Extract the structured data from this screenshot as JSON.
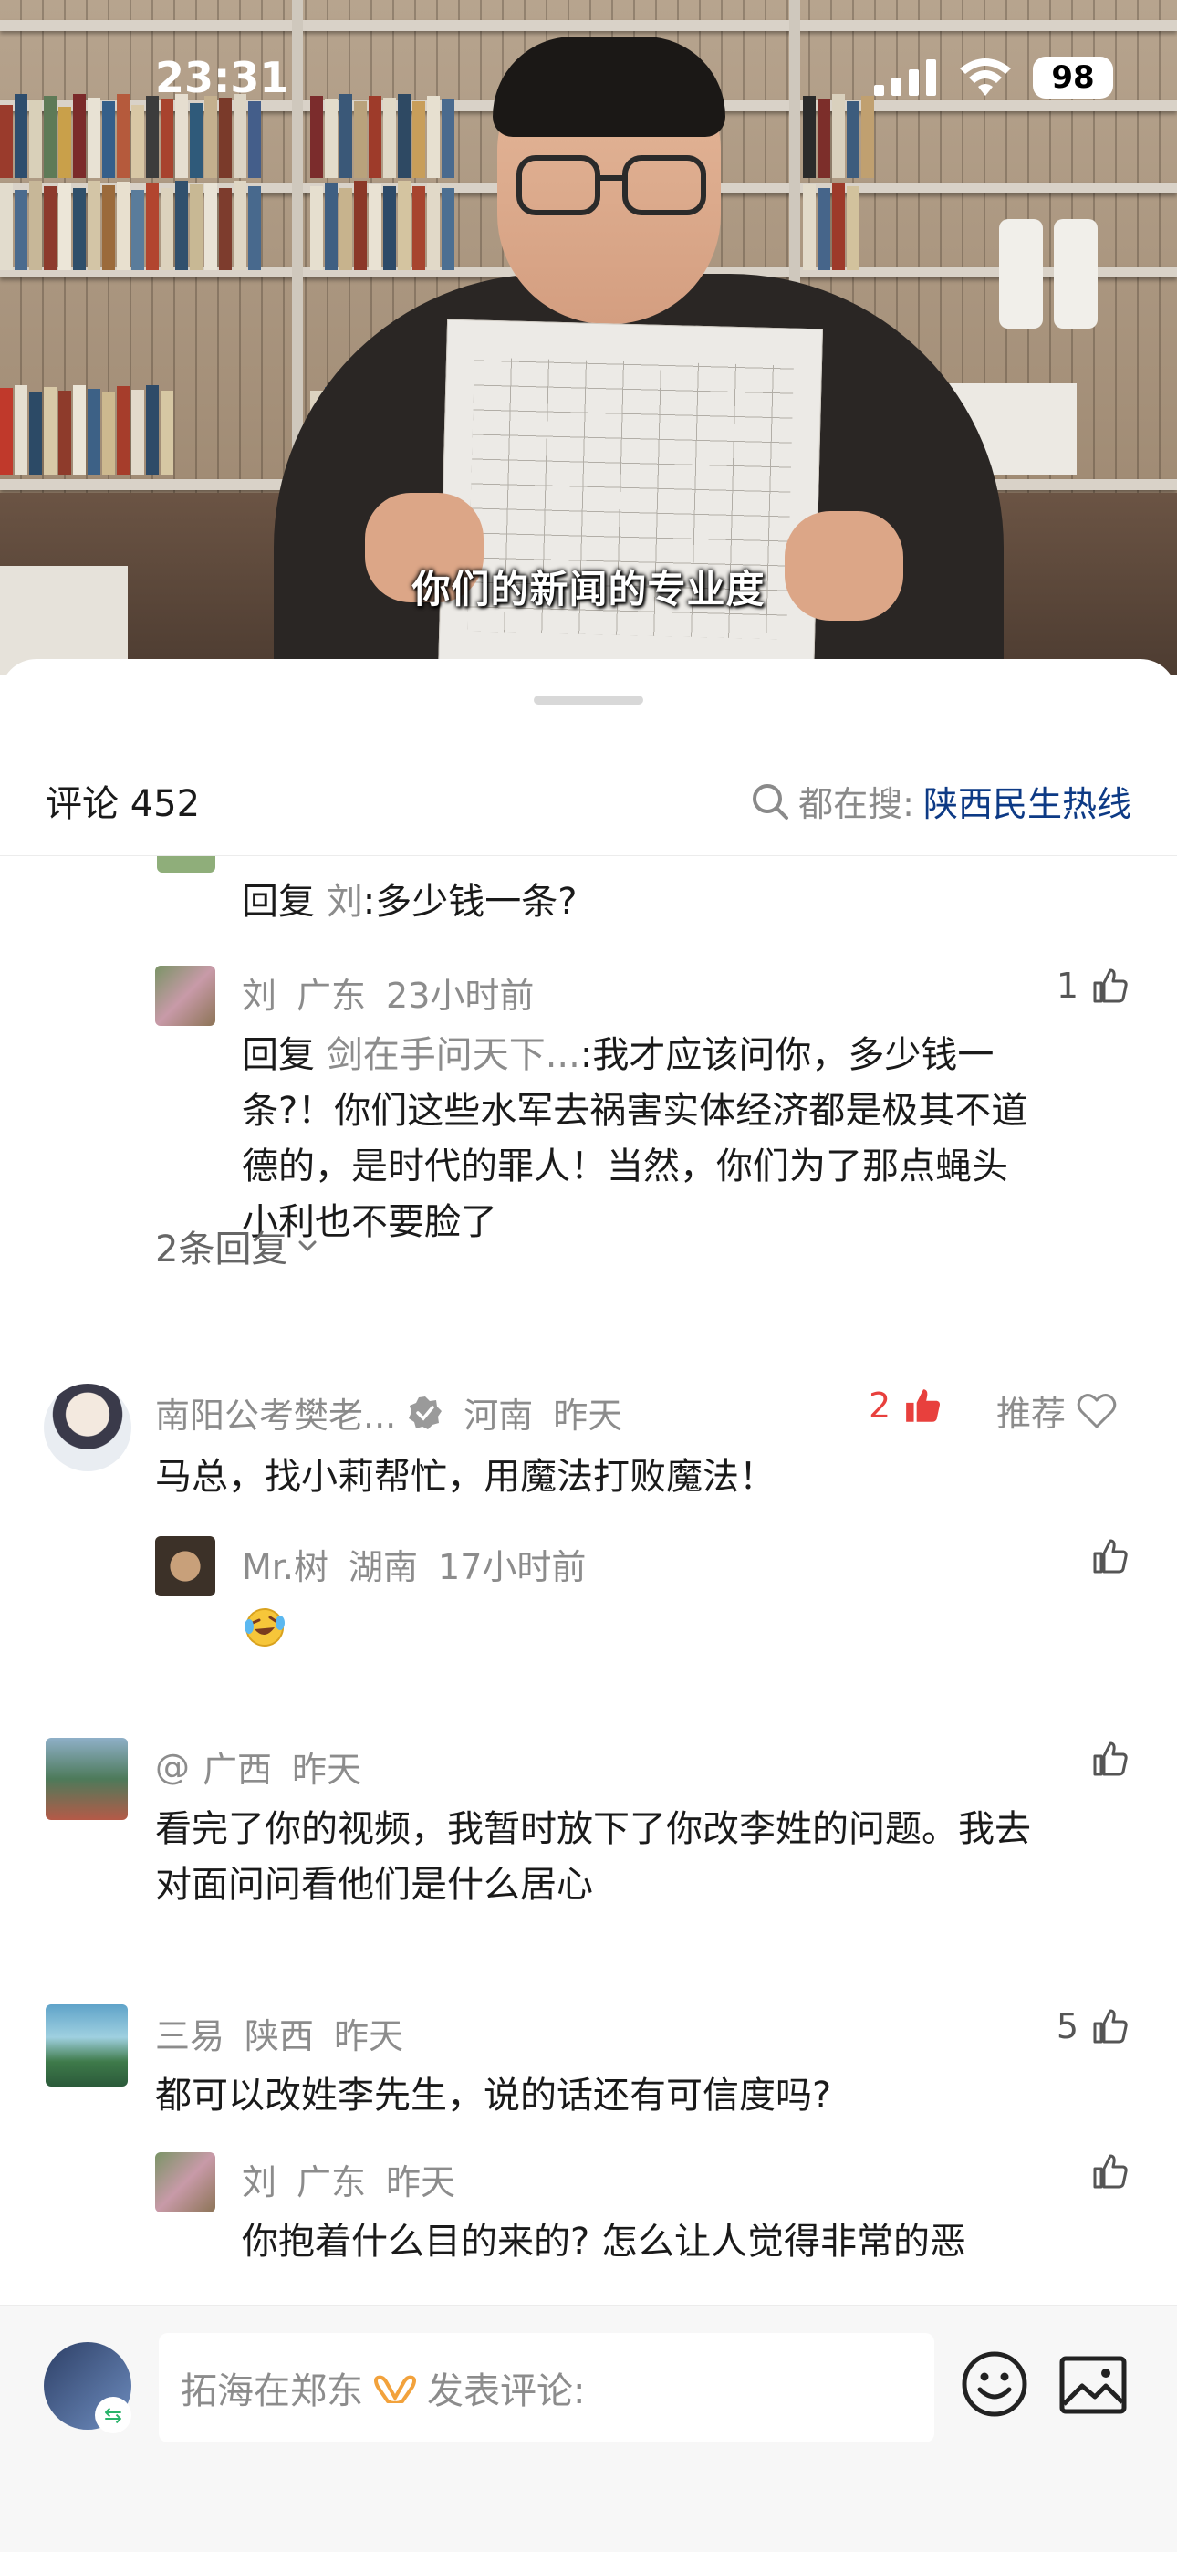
{
  "status_bar": {
    "time": "23:31",
    "battery": "98"
  },
  "video": {
    "subtitle": "你们的新闻的专业度"
  },
  "sheet": {
    "comment_count_label": "评论 452",
    "search_prefix": "都在搜:",
    "search_keyword": "陕西民生热线"
  },
  "comments": {
    "r0": {
      "prefix": "回复",
      "target": "刘",
      "text": ":多少钱一条?"
    },
    "r1": {
      "name": "刘",
      "region": "广东",
      "time": "23小时前",
      "likes": "1",
      "prefix": "回复",
      "target": "剑在手问天下...",
      "line1": ":我才应该问你，多少钱一",
      "line2": "条?！你们这些水军去祸害实体经济都是极其不道",
      "line3": "德的，是时代的罪人！当然，你们为了那点蝇头",
      "line4": "小利也不要脸了"
    },
    "more_replies": "2条回复",
    "c1": {
      "name": "南阳公考樊老...",
      "region": "河南",
      "time": "昨天",
      "likes": "2",
      "recommend": "推荐",
      "text": "马总，找小莉帮忙，用魔法打败魔法！"
    },
    "c1r1": {
      "name": "Mr.树",
      "region": "湖南",
      "time": "17小时前",
      "emoji": "laughing-tears-emoji"
    },
    "c2": {
      "name": "@",
      "region": "广西",
      "time": "昨天",
      "line1": "看完了你的视频，我暂时放下了你改李姓的问题。我去",
      "line2": "对面问问看他们是什么居心"
    },
    "c3": {
      "name": "三易",
      "region": "陕西",
      "time": "昨天",
      "likes": "5",
      "text": "都可以改姓李先生，说的话还有可信度吗?"
    },
    "c3r1": {
      "name": "刘",
      "region": "广东",
      "time": "昨天",
      "text": "你抱着什么目的来的? 怎么让人觉得非常的恶"
    }
  },
  "bottom_bar": {
    "username": "拓海在郑东",
    "input_placeholder": "发表评论:",
    "accent": "#0d3a85",
    "like_red": "#e8403d"
  }
}
